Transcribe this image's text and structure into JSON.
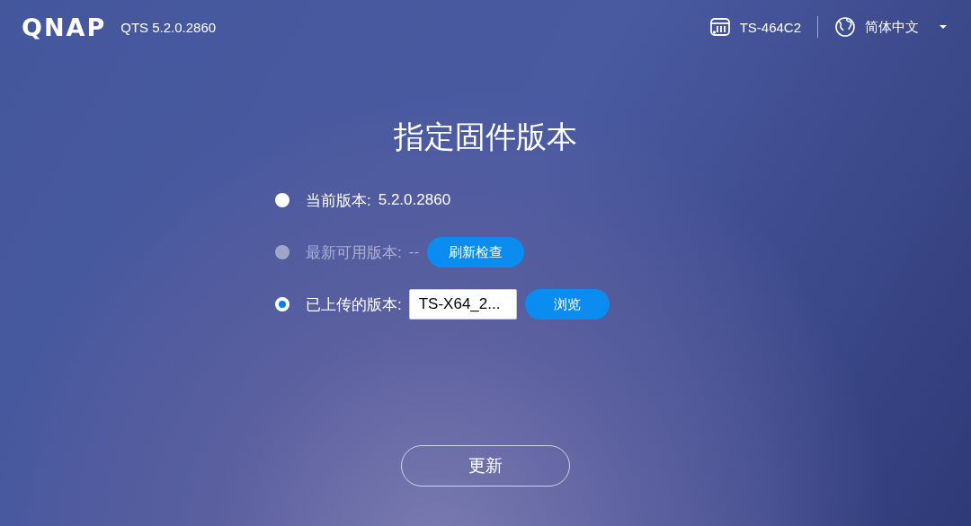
{
  "header": {
    "logo": "QNAP",
    "version": "QTS 5.2.0.2860",
    "device": "TS-464C2",
    "language": "简体中文"
  },
  "title": "指定固件版本",
  "options": [
    {
      "kind": "current",
      "label": "当前版本:",
      "value": "5.2.0.2860",
      "selected": false,
      "disabled": false
    },
    {
      "kind": "latest",
      "label": "最新可用版本:",
      "value": "--",
      "button": "刷新检查",
      "selected": false,
      "disabled": true
    },
    {
      "kind": "uploaded",
      "label": "已上传的版本:",
      "file": "TS-X64_2...",
      "button": "浏览",
      "selected": true,
      "disabled": false
    }
  ],
  "update_button": "更新"
}
